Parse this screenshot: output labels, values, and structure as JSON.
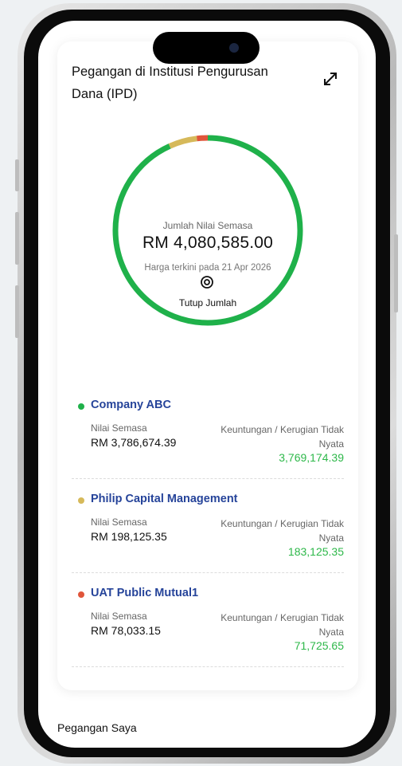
{
  "colors": {
    "primary_green": "#1fb14a",
    "gold": "#d6b95a",
    "red_orange": "#e0553a",
    "name_blue": "#26449a",
    "gain_green": "#2eb84a"
  },
  "card": {
    "title": "Pegangan di Institusi Pengurusan Dana (IPD)",
    "expand_icon": "expand-arrows-icon"
  },
  "summary": {
    "label": "Jumlah Nilai Semasa",
    "value": "RM 4,080,585.00",
    "date_text": "Harga terkini pada 21 Apr 2026",
    "toggle_icon": "eye-icon",
    "toggle_label": "Tutup Jumlah"
  },
  "holdings": [
    {
      "name": "Company ABC",
      "dot_color": "#1fb14a",
      "current_label": "Nilai Semasa",
      "current_value": "RM 3,786,674.39",
      "pl_label": "Keuntungan / Kerugian Tidak Nyata",
      "pl_value": "3,769,174.39"
    },
    {
      "name": "Philip Capital Management",
      "dot_color": "#d6b95a",
      "current_label": "Nilai Semasa",
      "current_value": "RM 198,125.35",
      "pl_label": "Keuntungan / Kerugian Tidak Nyata",
      "pl_value": "183,125.35"
    },
    {
      "name": "UAT Public Mutual1",
      "dot_color": "#e0553a",
      "current_label": "Nilai Semasa",
      "current_value": "RM 78,033.15",
      "pl_label": "Keuntungan / Kerugian Tidak Nyata",
      "pl_value": "71,725.65"
    }
  ],
  "footer": {
    "section_label": "Pegangan Saya"
  }
}
